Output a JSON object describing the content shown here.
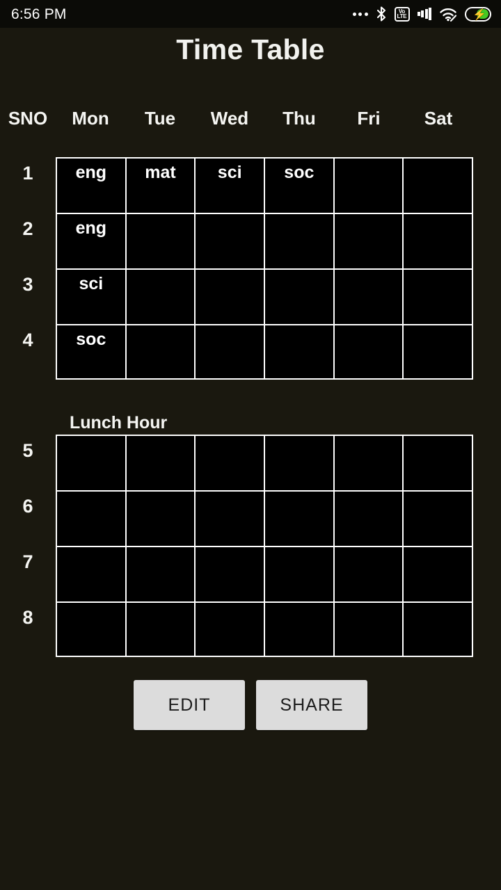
{
  "status_bar": {
    "clock": "6:56 PM",
    "icons": [
      {
        "name": "more-dots-icon",
        "glyph": "•••"
      },
      {
        "name": "bluetooth-icon",
        "glyph": "ᛦ"
      },
      {
        "name": "volte-icon",
        "top": "Vo",
        "bottom": "LTE"
      },
      {
        "name": "cellular-signal-icon",
        "glyph": "bars"
      },
      {
        "name": "wifi-icon",
        "glyph": "wifi"
      },
      {
        "name": "battery-charging-icon",
        "glyph": "⚡"
      }
    ],
    "battery_fill_color": "#46c823"
  },
  "header": {
    "title": "Time Table"
  },
  "table": {
    "columns": [
      "SNO",
      "Mon",
      "Tue",
      "Wed",
      "Thu",
      "Fri",
      "Sat"
    ],
    "sno_label": "SNO",
    "days": [
      "Mon",
      "Tue",
      "Wed",
      "Thu",
      "Fri",
      "Sat"
    ],
    "lunch_label": "Lunch Hour",
    "morning_rows": [
      {
        "sno": "1",
        "cells": [
          "eng",
          "mat",
          "sci",
          "soc",
          "",
          ""
        ]
      },
      {
        "sno": "2",
        "cells": [
          "eng",
          "",
          "",
          "",
          "",
          ""
        ]
      },
      {
        "sno": "3",
        "cells": [
          "sci",
          "",
          "",
          "",
          "",
          ""
        ]
      },
      {
        "sno": "4",
        "cells": [
          "soc",
          "",
          "",
          "",
          "",
          ""
        ]
      }
    ],
    "afternoon_rows": [
      {
        "sno": "5",
        "cells": [
          "",
          "",
          "",
          "",
          "",
          ""
        ]
      },
      {
        "sno": "6",
        "cells": [
          "",
          "",
          "",
          "",
          "",
          ""
        ]
      },
      {
        "sno": "7",
        "cells": [
          "",
          "",
          "",
          "",
          "",
          ""
        ]
      },
      {
        "sno": "8",
        "cells": [
          "",
          "",
          "",
          "",
          "",
          ""
        ]
      }
    ]
  },
  "actions": {
    "edit_label": "EDIT",
    "share_label": "SHARE"
  },
  "colors": {
    "background": "#1a180f",
    "cell_background": "#000000",
    "grid_line": "#ffffff",
    "text": "#f5f5f2",
    "button_background": "#dcdcdc",
    "button_text": "#1c1c1c"
  }
}
